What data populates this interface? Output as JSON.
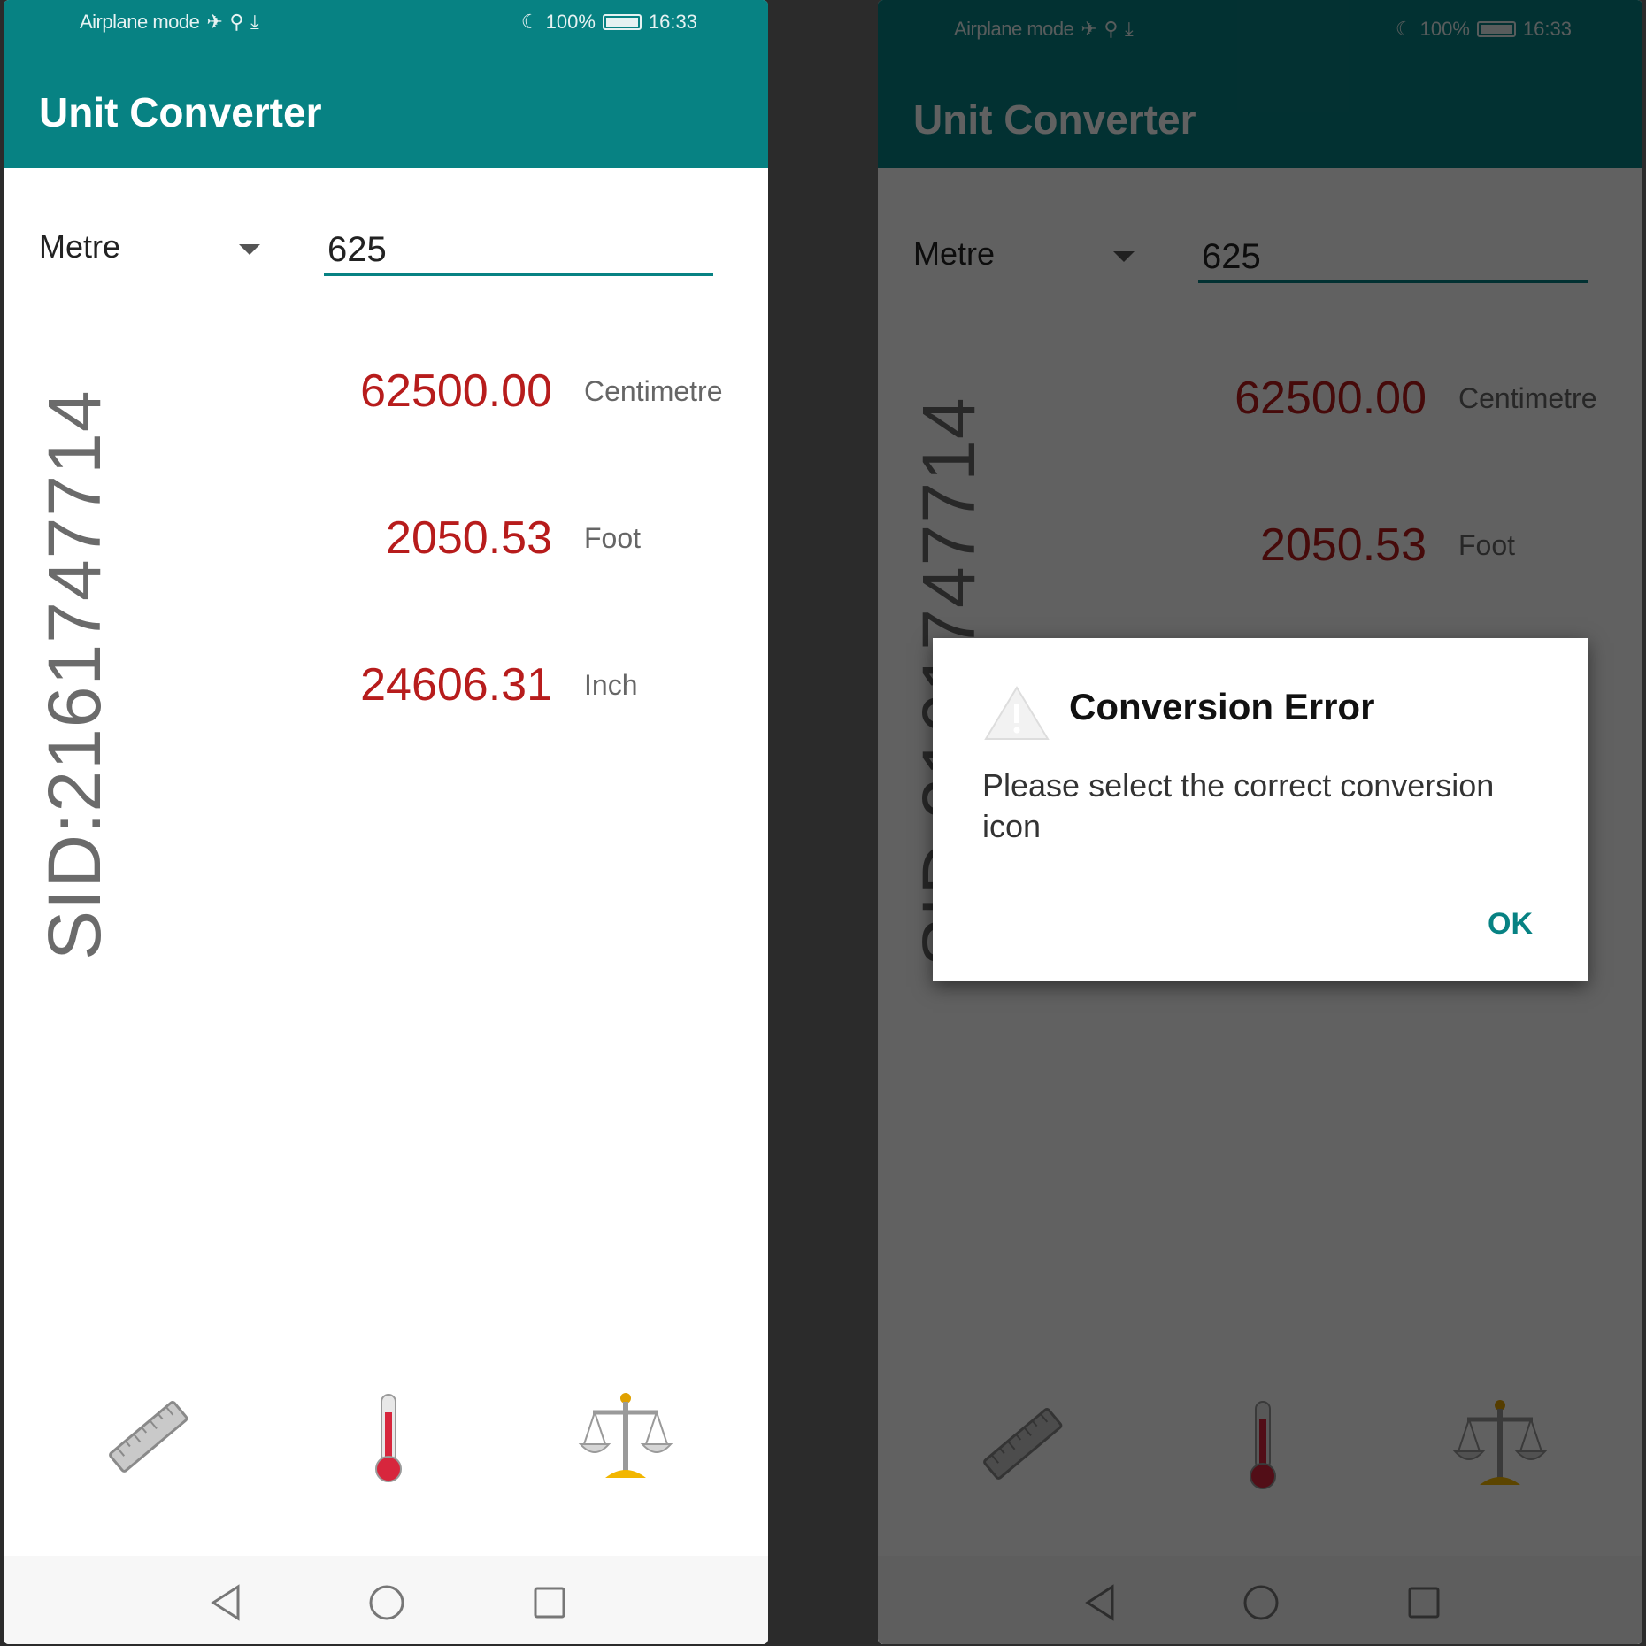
{
  "status_bar": {
    "left_text": "Airplane mode",
    "battery": "100%",
    "time": "16:33"
  },
  "app": {
    "title": "Unit Converter",
    "from_unit": "Metre",
    "input_value": "625"
  },
  "results": [
    {
      "value": "62500.00",
      "unit": "Centimetre"
    },
    {
      "value": "2050.53",
      "unit": "Foot"
    },
    {
      "value": "24606.31",
      "unit": "Inch"
    }
  ],
  "watermark": "SID:2161747714",
  "bottom_icons": [
    "ruler-icon",
    "thermometer-icon",
    "balance-scale-icon"
  ],
  "dialog": {
    "title": "Conversion Error",
    "message": "Please select the correct conversion icon",
    "ok_label": "OK"
  },
  "colors": {
    "primary": "#078283",
    "result_value": "#b71c1c",
    "dim_overlay": "rgba(0,0,0,0.62)"
  }
}
